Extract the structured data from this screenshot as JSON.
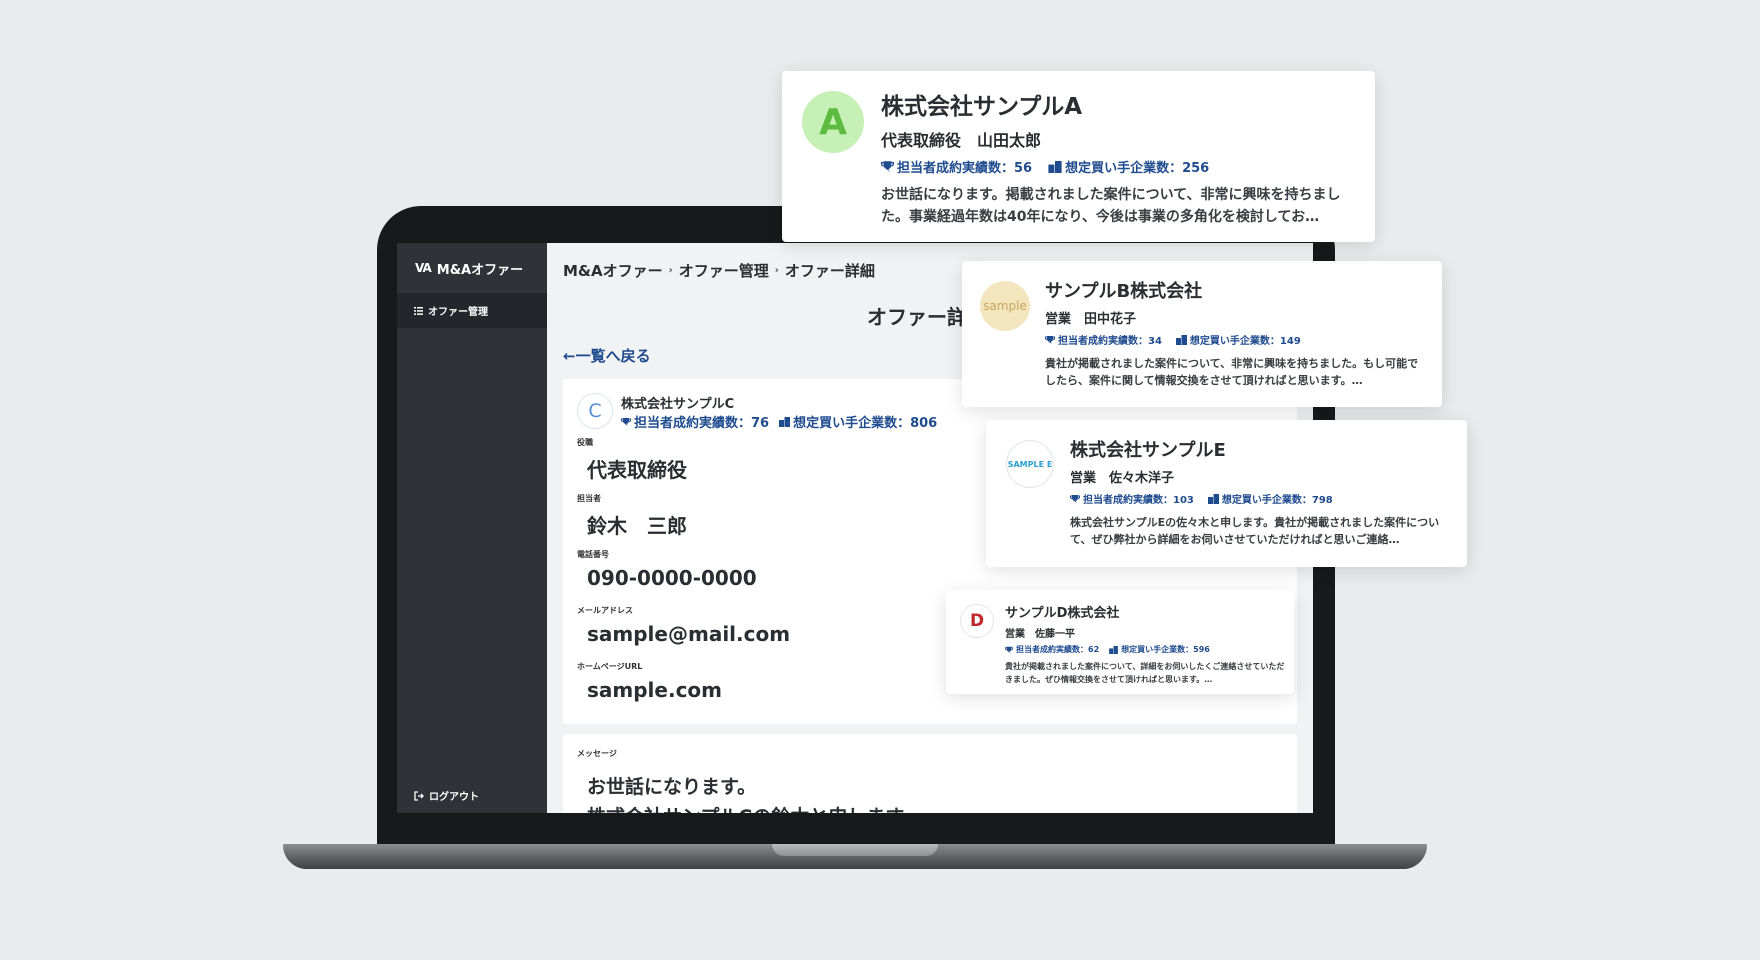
{
  "app": {
    "brand": "M&Aオファー",
    "brand_logo": "VA",
    "nav_offer_mgmt": "オファー管理",
    "logout": "ログアウト"
  },
  "breadcrumb": [
    "M&Aオファー",
    "オファー管理",
    "オファー詳細"
  ],
  "page_title": "オファー詳細",
  "back_link": "←一覧へ戻る",
  "detail": {
    "avatar_letter": "C",
    "company": "株式会社サンプルC",
    "stat_deals": "担当者成約実績数：76",
    "stat_buyers": "想定買い手企業数：806",
    "fields": [
      {
        "label": "役職",
        "value": "代表取締役"
      },
      {
        "label": "担当者",
        "value": "鈴木　三郎"
      },
      {
        "label": "電話番号",
        "value": "090-0000-0000"
      },
      {
        "label": "メールアドレス",
        "value": "sample@mail.com"
      },
      {
        "label": "ホームページURL",
        "value": "sample.com"
      }
    ],
    "message_label": "メッセージ",
    "message_lines": [
      "お世話になります。",
      "株式会社サンプルCの鈴木と申します。"
    ]
  },
  "offers": [
    {
      "avatar": "A",
      "company": "株式会社サンプルA",
      "person": "代表取締役　山田太郎",
      "stat_deals": "担当者成約実績数：56",
      "stat_buyers": "想定買い手企業数：256",
      "message": "お世話になります。掲載されました案件について、非常に興味を持ちました。事業経過年数は40年になり、今後は事業の多角化を検討してお…"
    },
    {
      "avatar": "sample",
      "company": "サンプルB株式会社",
      "person": "営業　田中花子",
      "stat_deals": "担当者成約実績数：34",
      "stat_buyers": "想定買い手企業数：149",
      "message": "貴社が掲載されました案件について、非常に興味を持ちました。もし可能でしたら、案件に関して情報交換をさせて頂ければと思います。…"
    },
    {
      "avatar": "SAMPLE E",
      "company": "株式会社サンプルE",
      "person": "営業　佐々木洋子",
      "stat_deals": "担当者成約実績数：103",
      "stat_buyers": "想定買い手企業数：798",
      "message": "株式会社サンプルEの佐々木と申します。貴社が掲載されました案件について、ぜひ弊社から詳細をお伺いさせていただければと思いご連絡…"
    },
    {
      "avatar": "D",
      "company": "サンプルD株式会社",
      "person": "営業　佐藤一平",
      "stat_deals": "担当者成約実績数：62",
      "stat_buyers": "想定買い手企業数：596",
      "message": "貴社が掲載されました案件について、詳細をお伺いしたくご連絡させていただきました。ぜひ情報交換をさせて頂ければと思います。…"
    }
  ],
  "colors": {
    "sidebar": "#2f3338",
    "accent_blue": "#1f4b8f",
    "avatar_a_bg": "#c6f0b5",
    "avatar_a_fg": "#5dbb3f",
    "avatar_b_bg": "#f3e6bf",
    "avatar_b_fg": "#c9a55a",
    "avatar_d_fg": "#c0282d",
    "avatar_e_fg": "#2a9fd0"
  },
  "icons": [
    "trophy-icon",
    "building-icon",
    "list-icon",
    "logout-icon",
    "chevron-right-icon"
  ]
}
